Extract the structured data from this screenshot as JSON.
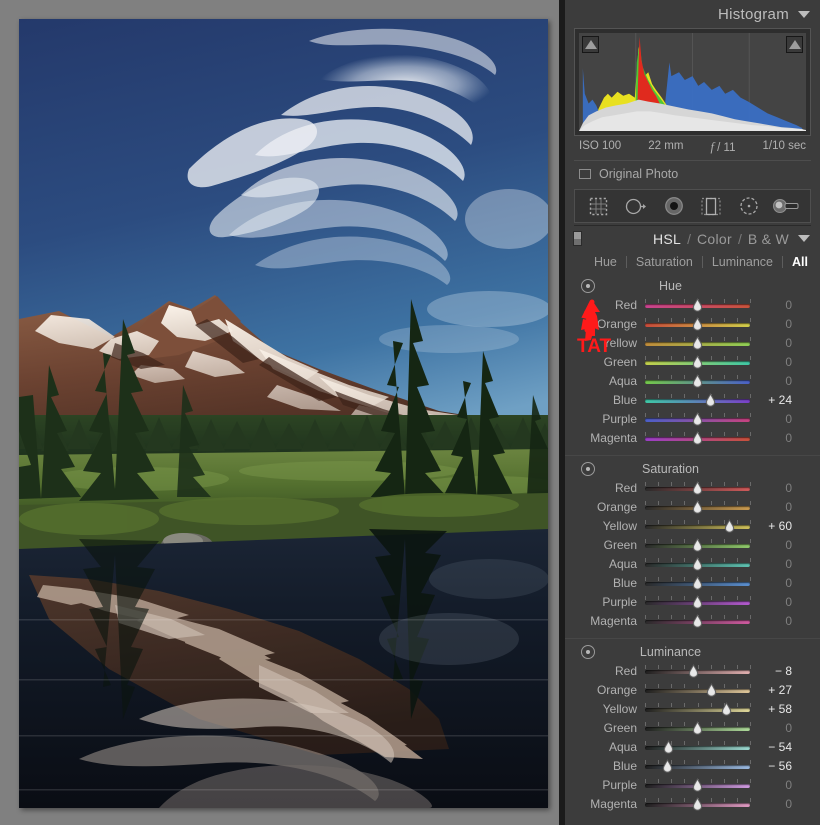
{
  "histogram": {
    "title": "Histogram",
    "collapse_icon": "triangle-down-icon",
    "clip_left_icon": "shadow-clipping-triangle-icon",
    "clip_right_icon": "highlight-clipping-triangle-icon",
    "exif": {
      "iso": "ISO 100",
      "focal_length": "22 mm",
      "aperture_prefix": "f",
      "aperture": "/ 11",
      "shutter": "1/10 sec"
    },
    "original_photo_label": "Original Photo",
    "original_photo_checked": false
  },
  "toolstrip": {
    "tools": [
      {
        "name": "crop-overlay-tool",
        "selected": false
      },
      {
        "name": "spot-removal-tool",
        "selected": false
      },
      {
        "name": "red-eye-correction-tool",
        "selected": true
      },
      {
        "name": "graduated-filter-tool",
        "selected": false
      },
      {
        "name": "radial-filter-tool",
        "selected": false
      },
      {
        "name": "adjustment-brush-tool",
        "selected": false
      }
    ]
  },
  "hsl_panel": {
    "modes": [
      {
        "label": "HSL",
        "active": true
      },
      {
        "label": "Color",
        "active": false
      },
      {
        "label": "B & W",
        "active": false
      }
    ],
    "separator": "/",
    "collapse_icon": "triangle-down-icon",
    "tabs": [
      {
        "label": "Hue",
        "selected": false
      },
      {
        "label": "Saturation",
        "selected": false
      },
      {
        "label": "Luminance",
        "selected": false
      },
      {
        "label": "All",
        "selected": true
      }
    ],
    "annotation": {
      "text": "TAT",
      "color": "#ff1a1a",
      "points_to": "targeted-adjustment-tool"
    },
    "groups": [
      {
        "title": "Hue",
        "tat_icon": "targeted-adjustment-tool",
        "sliders": [
          {
            "label": "Red",
            "value": 0,
            "display": "0",
            "pct": 50,
            "from": "#c8438f",
            "to": "#c8533a"
          },
          {
            "label": "Orange",
            "value": 0,
            "display": "0",
            "pct": 50,
            "from": "#c84a3a",
            "to": "#cfce4a"
          },
          {
            "label": "Yellow",
            "value": 0,
            "display": "0",
            "pct": 50,
            "from": "#c08b3a",
            "to": "#8fcf55"
          },
          {
            "label": "Green",
            "value": 0,
            "display": "0",
            "pct": 50,
            "from": "#c3cf4a",
            "to": "#3ec8a6"
          },
          {
            "label": "Aqua",
            "value": 0,
            "display": "0",
            "pct": 50,
            "from": "#74c84a",
            "to": "#4a5fc8"
          },
          {
            "label": "Blue",
            "value": 24,
            "display": "+ 24",
            "pct": 62,
            "from": "#3ec8a6",
            "to": "#7b3ec8"
          },
          {
            "label": "Purple",
            "value": 0,
            "display": "0",
            "pct": 50,
            "from": "#4a5fc8",
            "to": "#c8437f"
          },
          {
            "label": "Magenta",
            "value": 0,
            "display": "0",
            "pct": 50,
            "from": "#9a3ec8",
            "to": "#c8513a"
          }
        ]
      },
      {
        "title": "Saturation",
        "tat_icon": "targeted-adjustment-tool",
        "sliders": [
          {
            "label": "Red",
            "value": 0,
            "display": "0",
            "pct": 50,
            "from": "#2a2a2a",
            "to": "#d05a5a"
          },
          {
            "label": "Orange",
            "value": 0,
            "display": "0",
            "pct": 50,
            "from": "#2a2a2a",
            "to": "#c99a4f"
          },
          {
            "label": "Yellow",
            "value": 60,
            "display": "+ 60",
            "pct": 80,
            "from": "#2a2a2a",
            "to": "#cfc05a"
          },
          {
            "label": "Green",
            "value": 0,
            "display": "0",
            "pct": 50,
            "from": "#2a2a2a",
            "to": "#8fc96a"
          },
          {
            "label": "Aqua",
            "value": 0,
            "display": "0",
            "pct": 50,
            "from": "#2a2a2a",
            "to": "#5ec3b2"
          },
          {
            "label": "Blue",
            "value": 0,
            "display": "0",
            "pct": 50,
            "from": "#2a2a2a",
            "to": "#5a8fd0"
          },
          {
            "label": "Purple",
            "value": 0,
            "display": "0",
            "pct": 50,
            "from": "#2a2a2a",
            "to": "#b45ad0"
          },
          {
            "label": "Magenta",
            "value": 0,
            "display": "0",
            "pct": 50,
            "from": "#2a2a2a",
            "to": "#d05aa0"
          }
        ]
      },
      {
        "title": "Luminance",
        "tat_icon": "targeted-adjustment-tool",
        "sliders": [
          {
            "label": "Red",
            "value": -8,
            "display": "− 8",
            "pct": 46,
            "from": "#1f1f1f",
            "to": "#e2b0b0"
          },
          {
            "label": "Orange",
            "value": 27,
            "display": "+ 27",
            "pct": 63,
            "from": "#1f1f1f",
            "to": "#e0c79a"
          },
          {
            "label": "Yellow",
            "value": 58,
            "display": "+ 58",
            "pct": 78,
            "from": "#1f1f1f",
            "to": "#e0d89a"
          },
          {
            "label": "Green",
            "value": 0,
            "display": "0",
            "pct": 50,
            "from": "#1f1f1f",
            "to": "#aedb9a"
          },
          {
            "label": "Aqua",
            "value": -54,
            "display": "− 54",
            "pct": 22,
            "from": "#1f1f1f",
            "to": "#9ad8cf"
          },
          {
            "label": "Blue",
            "value": -56,
            "display": "− 56",
            "pct": 21,
            "from": "#1f1f1f",
            "to": "#9ab9e0"
          },
          {
            "label": "Purple",
            "value": 0,
            "display": "0",
            "pct": 50,
            "from": "#1f1f1f",
            "to": "#cf9ae0"
          },
          {
            "label": "Magenta",
            "value": 0,
            "display": "0",
            "pct": 50,
            "from": "#1f1f1f",
            "to": "#e09ac2"
          }
        ]
      }
    ]
  },
  "photo": {
    "name": "mountain-lake-reflection-photo",
    "description": "Snow-capped mountain with cirrus clouds reflected in an alpine lake"
  }
}
